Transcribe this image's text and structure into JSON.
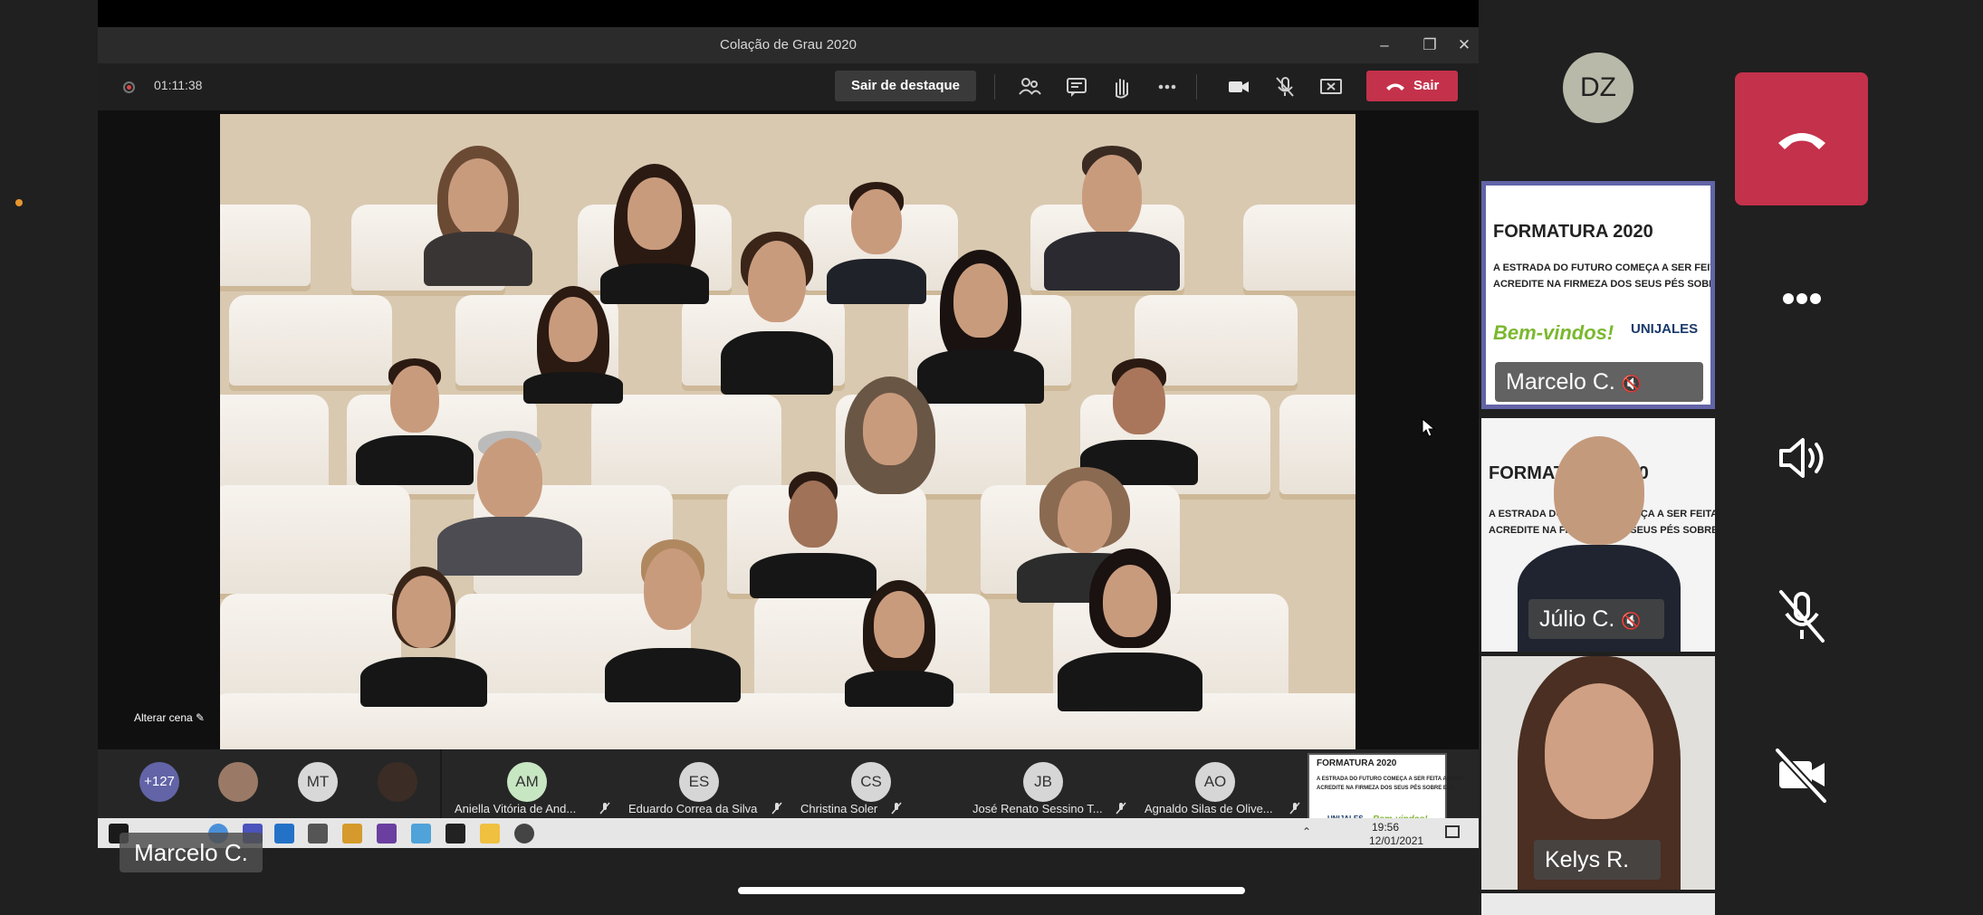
{
  "window": {
    "title": "Colação de Grau 2020"
  },
  "toolbar": {
    "timer": "01:11:38",
    "spotlight_label": "Sair de destaque",
    "leave_label": "Sair"
  },
  "stage": {
    "change_scene_label": "Alterar cena"
  },
  "participants": {
    "overflow_count": "+127",
    "avatars": [
      {
        "initials": "MT"
      }
    ],
    "tiles": [
      {
        "initials": "AM",
        "name": "Aniella Vitória de And...",
        "color": "#c7e6c2"
      },
      {
        "initials": "ES",
        "name": "Eduardo Correa da Silva",
        "color": "#d6d6d6"
      },
      {
        "initials": "CS",
        "name": "Christina Soler",
        "color": "#d6d6d6"
      },
      {
        "initials": "JB",
        "name": "José Renato Sessino T...",
        "color": "#d6d6d6"
      },
      {
        "initials": "AO",
        "name": "Agnaldo Silas de Olive...",
        "color": "#d6d6d6"
      }
    ]
  },
  "taskbar": {
    "time": "19:56",
    "date": "12/01/2021"
  },
  "overlay": {
    "presenter_name": "Marcelo C."
  },
  "self": {
    "initials": "DZ"
  },
  "right_tiles": [
    {
      "name": "Marcelo C."
    },
    {
      "name": "Júlio C."
    },
    {
      "name": "Kelys R."
    }
  ],
  "banner": {
    "title": "FORMATURA 2020",
    "brand": "UNIJALES",
    "line1": "A ESTRADA DO FUTURO COMEÇA A SER FEITA AGORA",
    "line2": "ACREDITE NA FIRMEZA DOS SEUS PÉS SOBRE ELA",
    "welcome": "Bem-vindos!"
  },
  "colors": {
    "accent": "#6264a7",
    "leave": "#c4314b"
  }
}
